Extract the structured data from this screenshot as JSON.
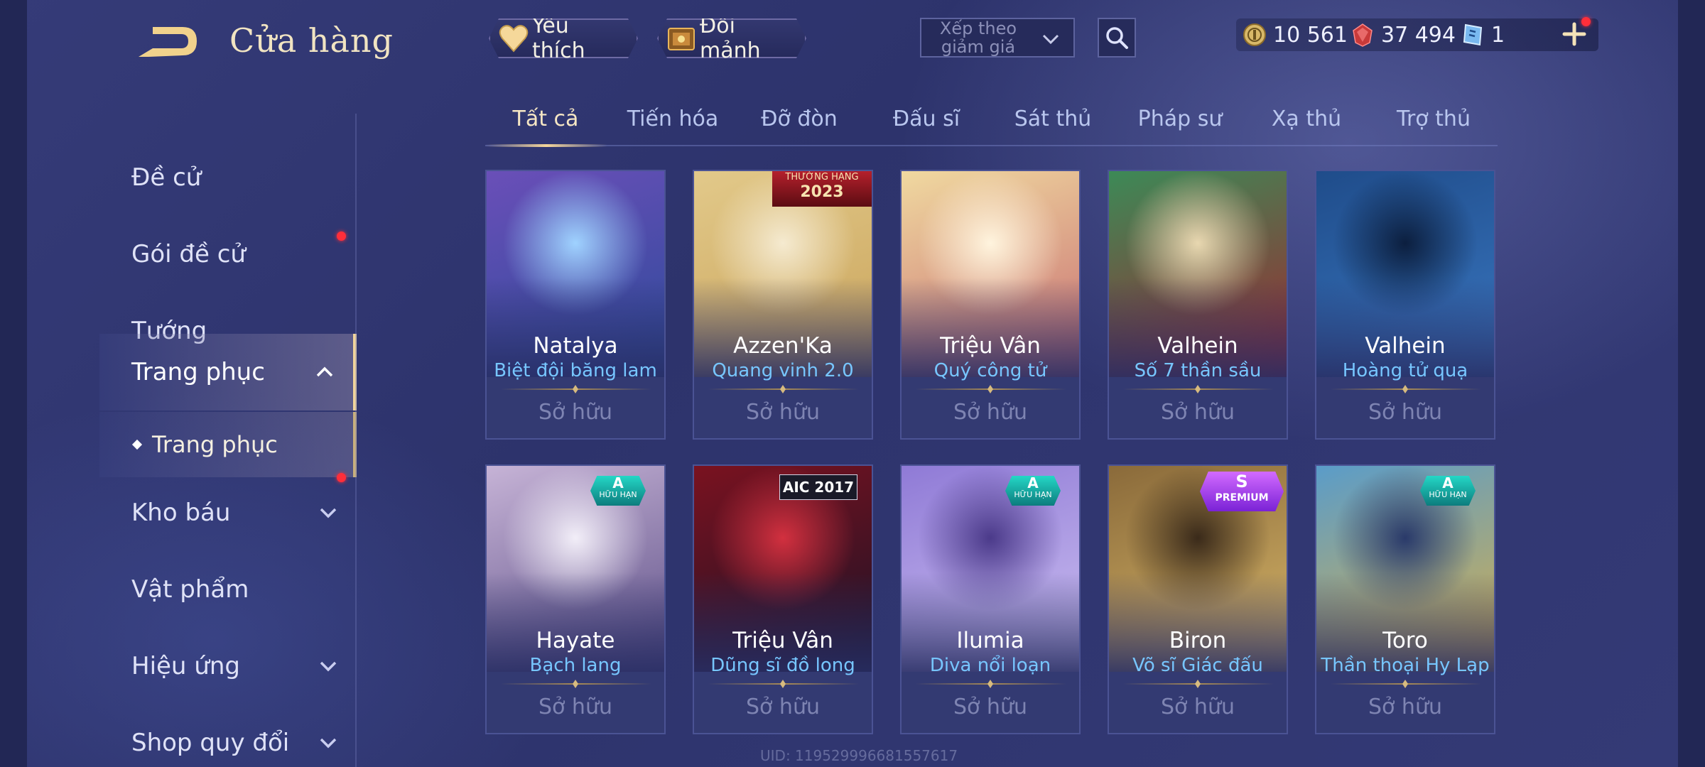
{
  "header": {
    "title": "Cửa hàng",
    "favorites_label": "Yêu thích",
    "shards_label": "Đổi mảnh",
    "sort_label": "Xếp theo giảm giá"
  },
  "currency": {
    "gold": "10 561",
    "ruby": "37 494",
    "voucher": "1"
  },
  "sidebar": {
    "items": [
      {
        "label": "Đề cử"
      },
      {
        "label": "Gói đề cử"
      },
      {
        "label": "Tướng"
      },
      {
        "label": "Trang phục"
      },
      {
        "label": "Kho báu"
      },
      {
        "label": "Vật phẩm"
      },
      {
        "label": "Hiệu ứng"
      },
      {
        "label": "Shop quy đổi"
      }
    ],
    "subitem": "Trang phục"
  },
  "tabs": [
    {
      "label": "Tất cả"
    },
    {
      "label": "Tiến hóa"
    },
    {
      "label": "Đỡ đòn"
    },
    {
      "label": "Đấu sĩ"
    },
    {
      "label": "Sát thủ"
    },
    {
      "label": "Pháp sư"
    },
    {
      "label": "Xạ thủ"
    },
    {
      "label": "Trợ thủ"
    }
  ],
  "cards": [
    {
      "hero": "Natalya",
      "skin": "Biệt đội băng lam",
      "status": "Sở hữu",
      "colors": [
        "#6a4fb8",
        "#2d4a9a",
        "#9fd2ff"
      ]
    },
    {
      "hero": "Azzen'Ka",
      "skin": "Quang vinh 2.0",
      "status": "Sở hữu",
      "badge_line1": "THƯỜNG HẠNG",
      "badge_line2": "2023",
      "colors": [
        "#e2c98a",
        "#c9a35a",
        "#f5ead0"
      ]
    },
    {
      "hero": "Triệu Vân",
      "skin": "Quý công tử",
      "status": "Sở hữu",
      "colors": [
        "#f0d9a0",
        "#c76b70",
        "#fff4de"
      ]
    },
    {
      "hero": "Valhein",
      "skin": "Số 7 thần sầu",
      "status": "Sở hữu",
      "colors": [
        "#3c8a57",
        "#a0262f",
        "#e8d7b0"
      ]
    },
    {
      "hero": "Valhein",
      "skin": "Hoàng tử quạ",
      "status": "Sở hữu",
      "colors": [
        "#1f4c8a",
        "#3a78c2",
        "#0c1f3f"
      ]
    },
    {
      "hero": "Hayate",
      "skin": "Bạch lang",
      "status": "Sở hữu",
      "badge_tier": "A",
      "badge_sub": "HỮU HẠN",
      "colors": [
        "#c6b3d6",
        "#5c4e86",
        "#f2eef8"
      ]
    },
    {
      "hero": "Triệu Vân",
      "skin": "Dũng sĩ đồ long",
      "status": "Sở hữu",
      "badge_text": "AIC 2017",
      "colors": [
        "#7a1220",
        "#1a1226",
        "#d2303f"
      ]
    },
    {
      "hero": "Ilumia",
      "skin": "Diva nổi loạn",
      "status": "Sở hữu",
      "badge_tier": "A",
      "badge_sub": "HỮU HẠN",
      "colors": [
        "#8f7ad6",
        "#cfc2f2",
        "#4b3a8a"
      ]
    },
    {
      "hero": "Biron",
      "skin": "Võ sĩ Giác đấu",
      "status": "Sở hữu",
      "badge_tier": "S",
      "badge_sub": "PREMIUM",
      "colors": [
        "#8a6a3a",
        "#d9b86a",
        "#3a2a1a"
      ]
    },
    {
      "hero": "Toro",
      "skin": "Thần thoại Hy Lạp",
      "status": "Sở hữu",
      "badge_tier": "A",
      "badge_sub": "HỮU HẠN",
      "colors": [
        "#5a9cc9",
        "#d9b04a",
        "#2a3a6a"
      ]
    }
  ],
  "uid": "UID: 119529996681557617"
}
